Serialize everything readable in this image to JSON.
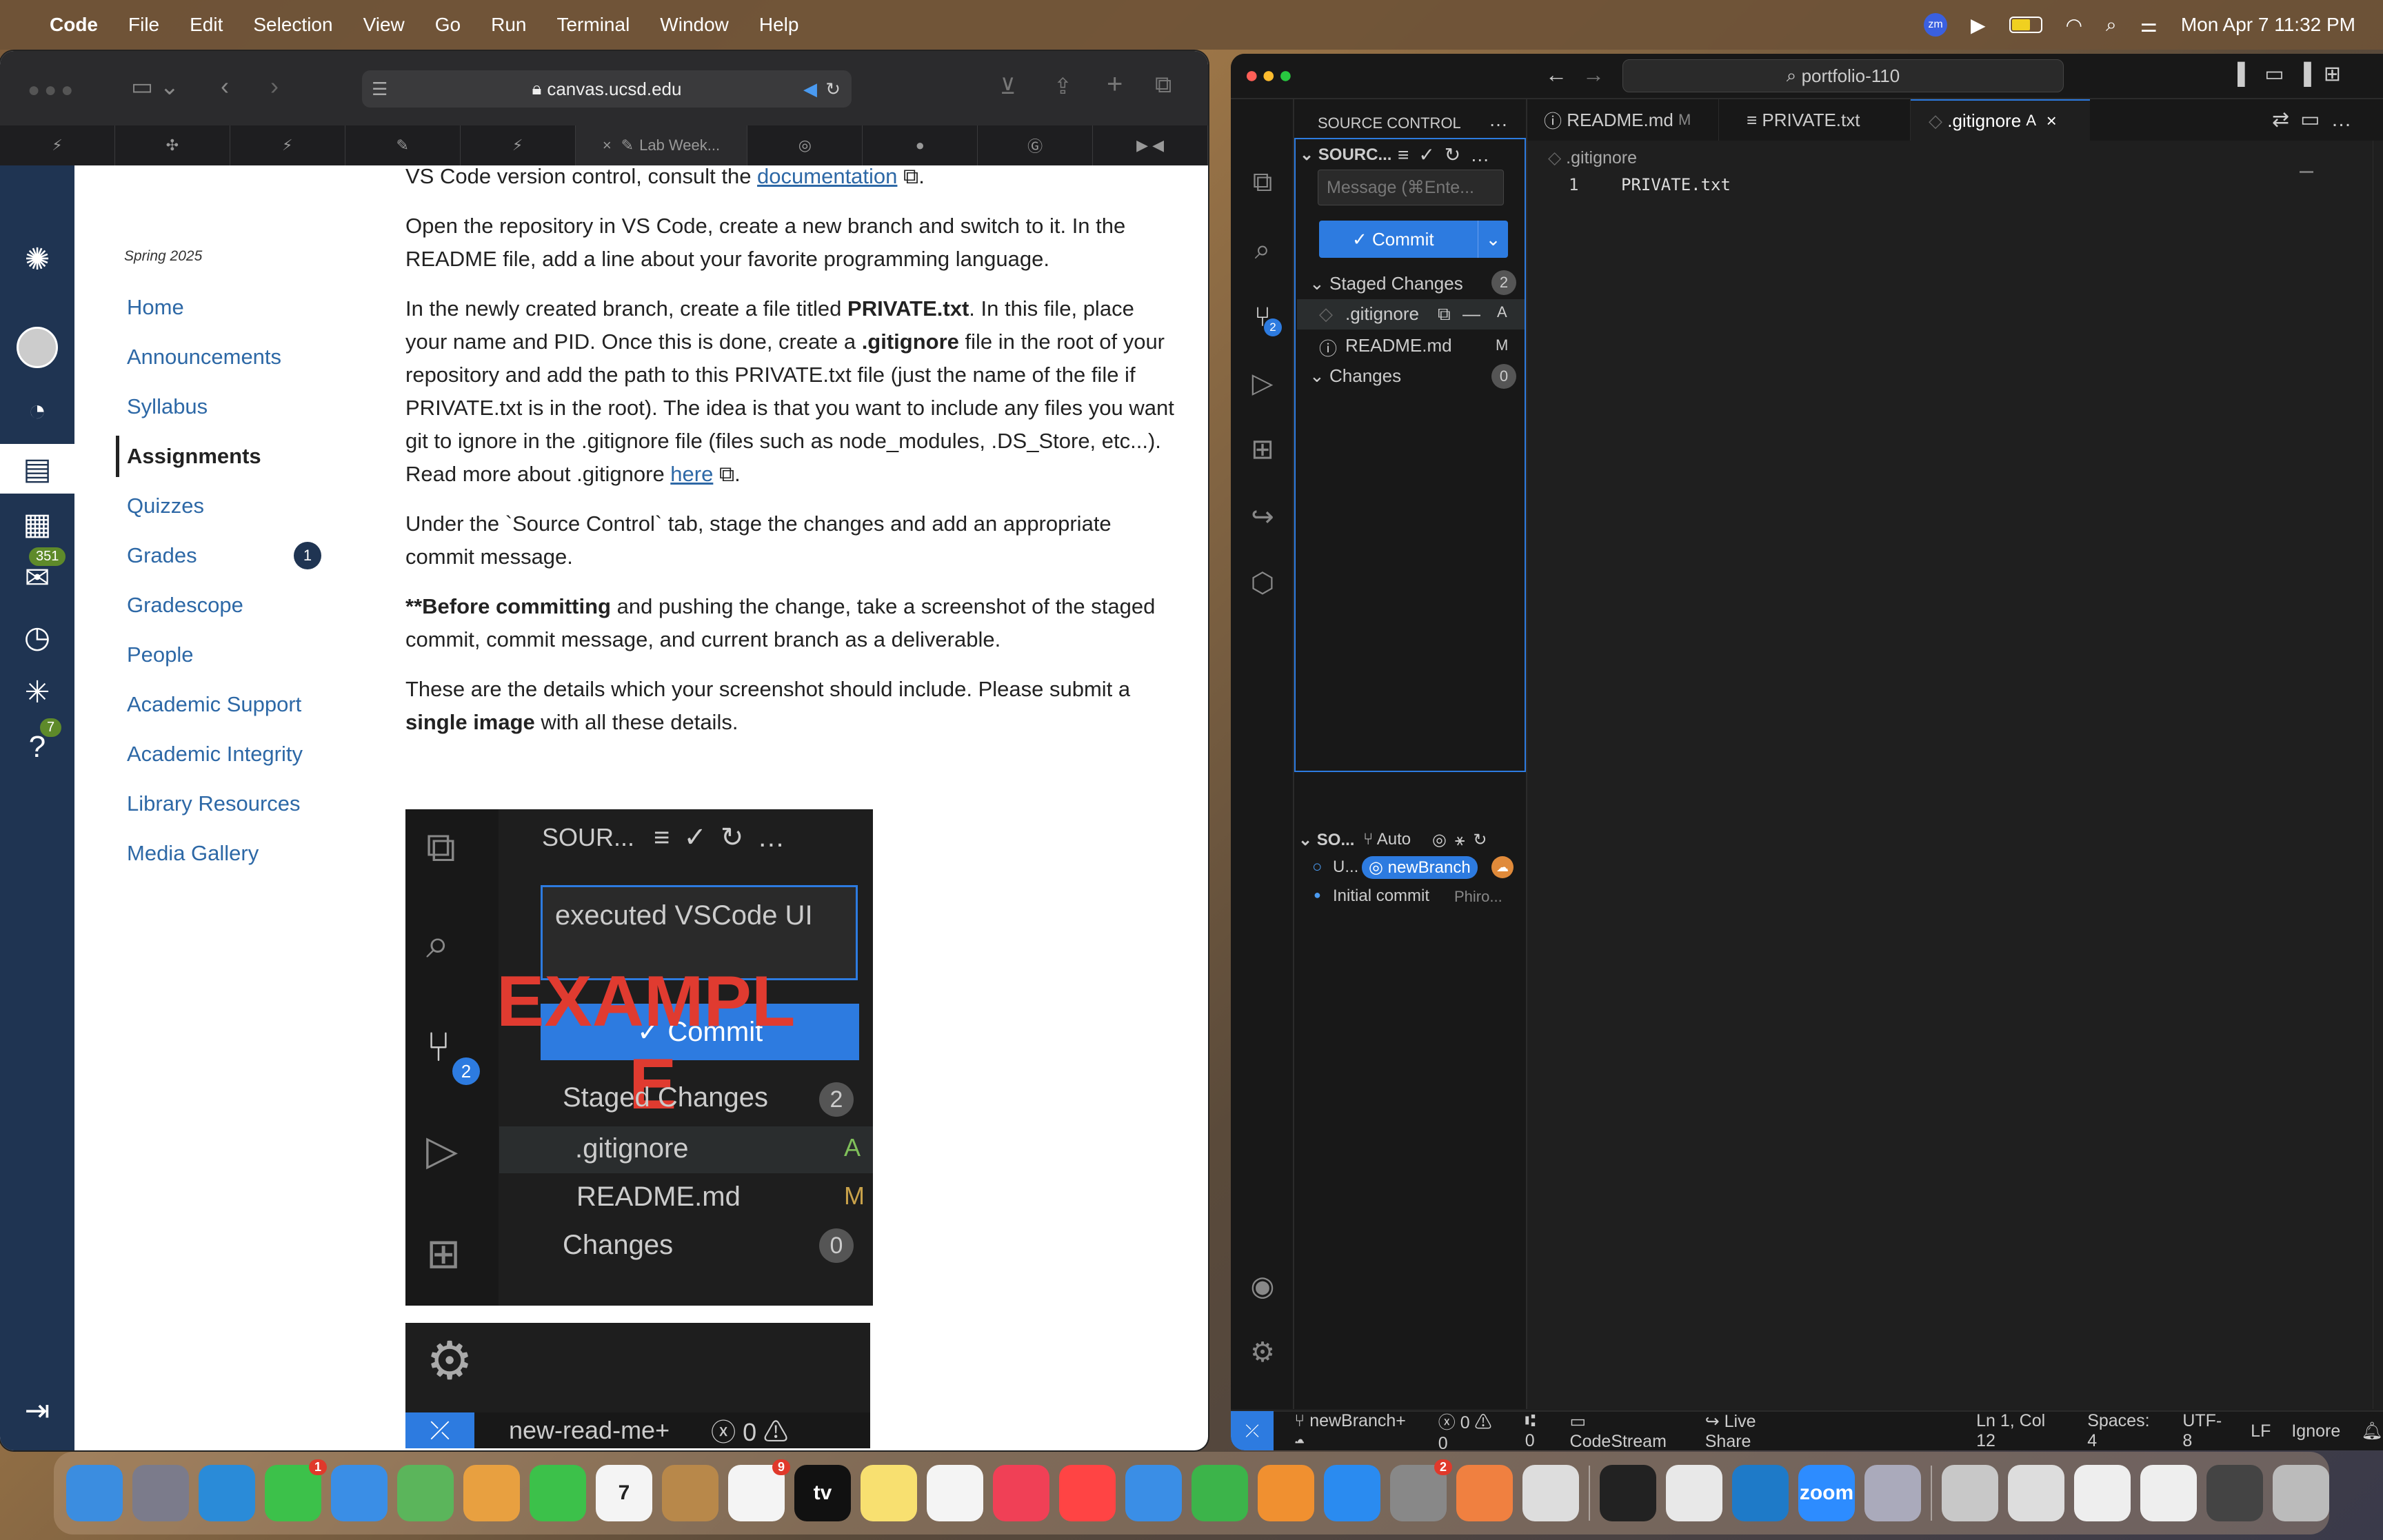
{
  "menubar": {
    "app": "Code",
    "items": [
      "File",
      "Edit",
      "Selection",
      "View",
      "Go",
      "Run",
      "Terminal",
      "Window",
      "Help"
    ],
    "clock": "Mon Apr 7  11:32 PM"
  },
  "safari": {
    "url": "canvas.ucsd.edu",
    "tab_text": "Lab Week..."
  },
  "canvas": {
    "term": "Spring 2025",
    "nav": [
      {
        "label": "Home"
      },
      {
        "label": "Announcements"
      },
      {
        "label": "Syllabus"
      },
      {
        "label": "Assignments",
        "active": true
      },
      {
        "label": "Quizzes"
      },
      {
        "label": "Grades",
        "badge": "1"
      },
      {
        "label": "Gradescope"
      },
      {
        "label": "People"
      },
      {
        "label": "Academic Support"
      },
      {
        "label": "Academic Integrity"
      },
      {
        "label": "Library Resources"
      },
      {
        "label": "Media Gallery"
      }
    ],
    "global_badges": {
      "inbox": "351",
      "help": "7"
    }
  },
  "content": {
    "p0_pre": "VS Code version control, consult the ",
    "p0_link": "documentation",
    "p1": "Open the repository in VS Code, create a new branch and switch to it. In the README file, add a line about your favorite programming language.",
    "p2_a": "In the newly created branch, create a file titled ",
    "p2_b": "PRIVATE.txt",
    "p2_c": ". In this file, place your name and PID. Once this is done, create a ",
    "p2_d": ".gitignore",
    "p2_e": " file in the root of your repository and add the path to this PRIVATE.txt file (just the name of the file if PRIVATE.txt is in the root). The idea is that you want to include any files you want git to ignore in the .gitignore file (files such as node_modules, .DS_Store, etc...). Read more about .gitignore ",
    "p2_link": "here",
    "p3": "Under the `Source Control` tab, stage the changes and add an appropriate commit message.",
    "p4_a": "**",
    "p4_b": "Before committing",
    "p4_c": " and pushing the change, take a screenshot of the staged commit, commit message, and current branch as a deliverable.",
    "p5_a": "These are the details which your screenshot should include. Please submit a ",
    "p5_b": "single image",
    "p5_c": " with all these details."
  },
  "example": {
    "header": "SOUR...",
    "message": "executed VSCode UI",
    "watermark1": "EXAMPL",
    "watermark2": "E",
    "commit": "Commit",
    "staged": "Staged Changes",
    "staged_count": "2",
    "files": [
      {
        "name": ".gitignore",
        "status": "A"
      },
      {
        "name": "README.md",
        "status": "M"
      }
    ],
    "changes": "Changes",
    "changes_count": "0",
    "scm_badge": "2",
    "branch": "new-read-me+",
    "errors": "0"
  },
  "vscode": {
    "search": "portfolio-110",
    "tabs": [
      {
        "name": "README.md",
        "status": "M"
      },
      {
        "name": "PRIVATE.txt",
        "status": ""
      },
      {
        "name": ".gitignore",
        "status": "A"
      }
    ],
    "panel_title": "SOURCE CONTROL",
    "section": "SOURC...",
    "msg_placeholder": "Message (⌘Ente...",
    "commit": "Commit",
    "staged": "Staged Changes",
    "staged_count": "2",
    "files": [
      {
        "name": ".gitignore",
        "status": "A"
      },
      {
        "name": "README.md",
        "status": "M"
      }
    ],
    "changes": "Changes",
    "changes_count": "0",
    "graph_title": "SO...",
    "graph_auto": "Auto",
    "graph_row1": "U...",
    "graph_branch": "newBranch",
    "graph_row2": "Initial commit",
    "graph_author": "Phiro...",
    "breadcrumb": ".gitignore",
    "line_no": "1",
    "line_text": "PRIVATE.txt",
    "scm_badge": "2",
    "status": {
      "branch": "newBranch+",
      "errors": "0",
      "warnings": "0",
      "ports": "0",
      "codestream": "CodeStream",
      "liveshare": "Live Share",
      "pos": "Ln 1, Col 12",
      "spaces": "Spaces: 4",
      "enc": "UTF-8",
      "eol": "LF",
      "lang": "Ignore"
    }
  },
  "dock": {
    "apps": [
      {
        "name": "Finder",
        "color": "#3b8de0"
      },
      {
        "name": "Launchpad",
        "color": "#7b7b8b"
      },
      {
        "name": "Safari",
        "color": "#2a8bd8"
      },
      {
        "name": "Messages",
        "color": "#3cc14a",
        "badge": "1"
      },
      {
        "name": "Mail",
        "color": "#3a8ee6"
      },
      {
        "name": "Maps",
        "color": "#5bb55b"
      },
      {
        "name": "Photos",
        "color": "#e8a040"
      },
      {
        "name": "FaceTime",
        "color": "#3cc14a"
      },
      {
        "name": "Calendar",
        "color": "#f4f4f4",
        "text": "7"
      },
      {
        "name": "Contacts",
        "color": "#b8884a"
      },
      {
        "name": "Reminders",
        "color": "#f4f4f4",
        "badge": "9"
      },
      {
        "name": "TV",
        "color": "#111",
        "text": "tv"
      },
      {
        "name": "Notes",
        "color": "#f8e070"
      },
      {
        "name": "Freeform",
        "color": "#f4f4f4"
      },
      {
        "name": "Music",
        "color": "#f04056"
      },
      {
        "name": "News",
        "color": "#f44"
      },
      {
        "name": "Keynote",
        "color": "#3a8ee6"
      },
      {
        "name": "Numbers",
        "color": "#3cb44a"
      },
      {
        "name": "Pages",
        "color": "#f09030"
      },
      {
        "name": "App Store",
        "color": "#2a8bf0"
      },
      {
        "name": "Settings",
        "color": "#888",
        "badge": "2"
      },
      {
        "name": "Transloader",
        "color": "#f08040"
      },
      {
        "name": "iPhone Mirroring",
        "color": "#ddd"
      },
      {
        "name": "Terminal",
        "color": "#222"
      },
      {
        "name": "Chrome",
        "color": "#e8e8e8"
      },
      {
        "name": "VS Code",
        "color": "#1e7ac8"
      },
      {
        "name": "Zoom",
        "color": "#2d8cff",
        "text": "zoom"
      },
      {
        "name": "Preview",
        "color": "#aab"
      },
      {
        "name": "Folder1",
        "color": "#c8c8c8"
      },
      {
        "name": "Folder2",
        "color": "#ddd"
      },
      {
        "name": "Doc1",
        "color": "#eee"
      },
      {
        "name": "Doc2",
        "color": "#eee"
      },
      {
        "name": "Doc3",
        "color": "#444"
      },
      {
        "name": "Trash",
        "color": "#bbb"
      }
    ]
  }
}
